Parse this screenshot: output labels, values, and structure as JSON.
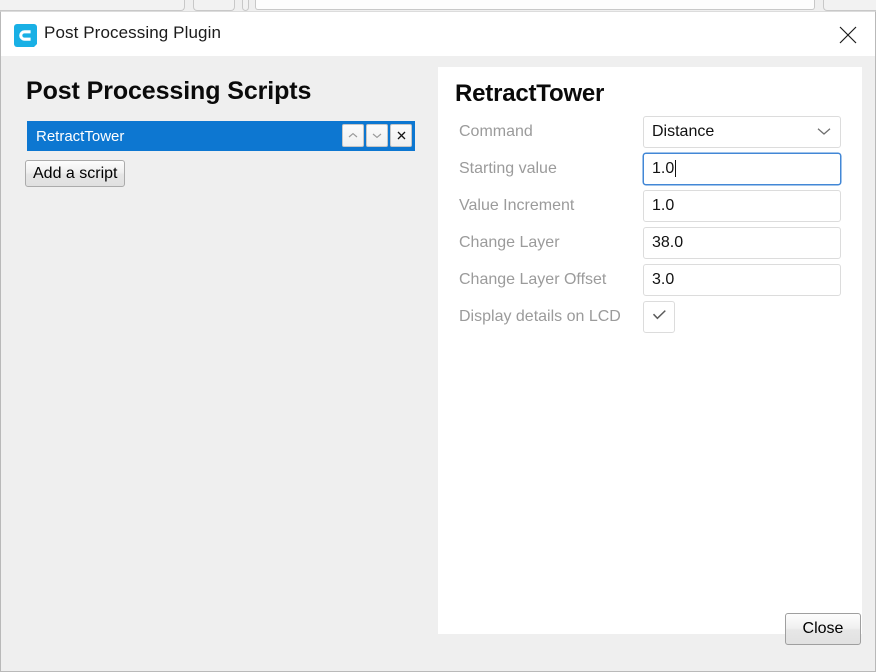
{
  "window": {
    "title": "Post Processing Plugin",
    "logo_icon": "cura-logo-icon",
    "close_icon": "close-icon"
  },
  "left_panel": {
    "heading": "Post Processing Scripts",
    "scripts": [
      {
        "name": "RetractTower",
        "selected": true,
        "move_up_icon": "chevron-up-icon",
        "move_down_icon": "chevron-down-icon",
        "remove_icon": "close-small-icon"
      }
    ],
    "add_script_label": "Add a script",
    "selection_color": "#0d77d1"
  },
  "settings_panel": {
    "title": "RetractTower",
    "rows": [
      {
        "label": "Command",
        "type": "combo",
        "value": "Distance",
        "chevron_icon": "chevron-down-icon",
        "focused": false
      },
      {
        "label": "Starting value",
        "type": "text",
        "value": "1.0",
        "focused": true
      },
      {
        "label": "Value Increment",
        "type": "text",
        "value": "1.0",
        "focused": false
      },
      {
        "label": "Change Layer",
        "type": "text",
        "value": "38.0",
        "focused": false
      },
      {
        "label": "Change Layer Offset",
        "type": "text",
        "value": "3.0",
        "focused": false
      },
      {
        "label": "Display details on LCD",
        "type": "checkbox",
        "checked": true,
        "check_icon": "check-icon",
        "focused": false
      }
    ],
    "focus_color": "#4287d6",
    "label_color": "#9b9b9b"
  },
  "footer": {
    "close_label": "Close"
  }
}
